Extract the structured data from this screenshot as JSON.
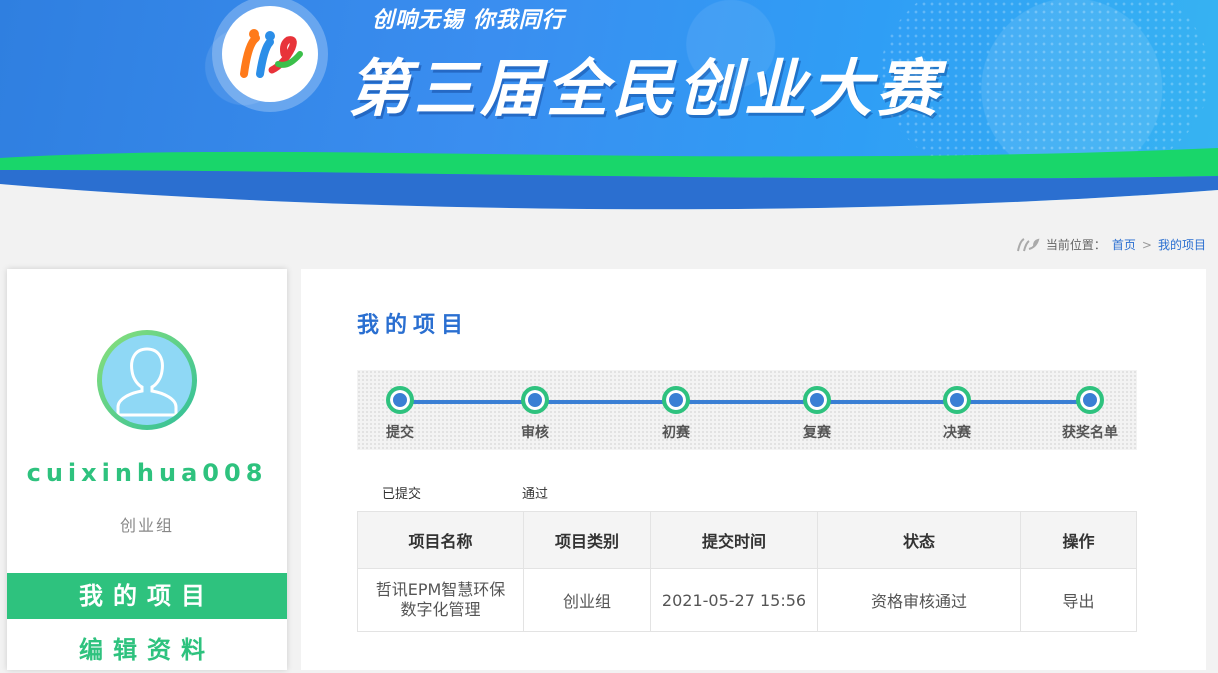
{
  "banner": {
    "slogan": "创响无锡 你我同行",
    "title": "第三届全民创业大赛"
  },
  "breadcrumb": {
    "prefix": "当前位置：",
    "home": "首页",
    "separator": ">",
    "current": "我的项目"
  },
  "sidebar": {
    "username": "cuixinhua008",
    "group": "创业组",
    "menu": [
      {
        "label": "我的项目",
        "active": true
      },
      {
        "label": "编辑资料",
        "active": false
      }
    ]
  },
  "main": {
    "title": "我的项目",
    "steps": [
      "提交",
      "审核",
      "初赛",
      "复赛",
      "决赛",
      "获奖名单"
    ],
    "step_status": [
      "已提交",
      "通过"
    ],
    "table": {
      "headers": [
        "项目名称",
        "项目类别",
        "提交时间",
        "状态",
        "操作"
      ],
      "rows": [
        {
          "name_line1": "哲讯EPM智慧环保",
          "name_line2": "数字化管理",
          "category": "创业组",
          "submitted": "2021-05-27 15:56",
          "status": "资格审核通过",
          "action": "导出"
        }
      ]
    }
  },
  "colors": {
    "accent_green": "#2ec27e",
    "accent_blue": "#2a6fd1",
    "banner_blue": "#3a8ef0"
  }
}
